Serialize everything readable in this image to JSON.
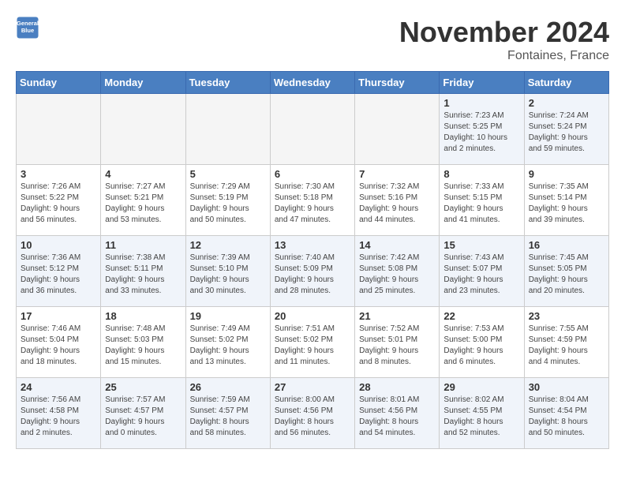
{
  "logo": {
    "line1": "General",
    "line2": "Blue"
  },
  "title": "November 2024",
  "location": "Fontaines, France",
  "days_header": [
    "Sunday",
    "Monday",
    "Tuesday",
    "Wednesday",
    "Thursday",
    "Friday",
    "Saturday"
  ],
  "weeks": [
    [
      {
        "num": "",
        "info": ""
      },
      {
        "num": "",
        "info": ""
      },
      {
        "num": "",
        "info": ""
      },
      {
        "num": "",
        "info": ""
      },
      {
        "num": "",
        "info": ""
      },
      {
        "num": "1",
        "info": "Sunrise: 7:23 AM\nSunset: 5:25 PM\nDaylight: 10 hours\nand 2 minutes."
      },
      {
        "num": "2",
        "info": "Sunrise: 7:24 AM\nSunset: 5:24 PM\nDaylight: 9 hours\nand 59 minutes."
      }
    ],
    [
      {
        "num": "3",
        "info": "Sunrise: 7:26 AM\nSunset: 5:22 PM\nDaylight: 9 hours\nand 56 minutes."
      },
      {
        "num": "4",
        "info": "Sunrise: 7:27 AM\nSunset: 5:21 PM\nDaylight: 9 hours\nand 53 minutes."
      },
      {
        "num": "5",
        "info": "Sunrise: 7:29 AM\nSunset: 5:19 PM\nDaylight: 9 hours\nand 50 minutes."
      },
      {
        "num": "6",
        "info": "Sunrise: 7:30 AM\nSunset: 5:18 PM\nDaylight: 9 hours\nand 47 minutes."
      },
      {
        "num": "7",
        "info": "Sunrise: 7:32 AM\nSunset: 5:16 PM\nDaylight: 9 hours\nand 44 minutes."
      },
      {
        "num": "8",
        "info": "Sunrise: 7:33 AM\nSunset: 5:15 PM\nDaylight: 9 hours\nand 41 minutes."
      },
      {
        "num": "9",
        "info": "Sunrise: 7:35 AM\nSunset: 5:14 PM\nDaylight: 9 hours\nand 39 minutes."
      }
    ],
    [
      {
        "num": "10",
        "info": "Sunrise: 7:36 AM\nSunset: 5:12 PM\nDaylight: 9 hours\nand 36 minutes."
      },
      {
        "num": "11",
        "info": "Sunrise: 7:38 AM\nSunset: 5:11 PM\nDaylight: 9 hours\nand 33 minutes."
      },
      {
        "num": "12",
        "info": "Sunrise: 7:39 AM\nSunset: 5:10 PM\nDaylight: 9 hours\nand 30 minutes."
      },
      {
        "num": "13",
        "info": "Sunrise: 7:40 AM\nSunset: 5:09 PM\nDaylight: 9 hours\nand 28 minutes."
      },
      {
        "num": "14",
        "info": "Sunrise: 7:42 AM\nSunset: 5:08 PM\nDaylight: 9 hours\nand 25 minutes."
      },
      {
        "num": "15",
        "info": "Sunrise: 7:43 AM\nSunset: 5:07 PM\nDaylight: 9 hours\nand 23 minutes."
      },
      {
        "num": "16",
        "info": "Sunrise: 7:45 AM\nSunset: 5:05 PM\nDaylight: 9 hours\nand 20 minutes."
      }
    ],
    [
      {
        "num": "17",
        "info": "Sunrise: 7:46 AM\nSunset: 5:04 PM\nDaylight: 9 hours\nand 18 minutes."
      },
      {
        "num": "18",
        "info": "Sunrise: 7:48 AM\nSunset: 5:03 PM\nDaylight: 9 hours\nand 15 minutes."
      },
      {
        "num": "19",
        "info": "Sunrise: 7:49 AM\nSunset: 5:02 PM\nDaylight: 9 hours\nand 13 minutes."
      },
      {
        "num": "20",
        "info": "Sunrise: 7:51 AM\nSunset: 5:02 PM\nDaylight: 9 hours\nand 11 minutes."
      },
      {
        "num": "21",
        "info": "Sunrise: 7:52 AM\nSunset: 5:01 PM\nDaylight: 9 hours\nand 8 minutes."
      },
      {
        "num": "22",
        "info": "Sunrise: 7:53 AM\nSunset: 5:00 PM\nDaylight: 9 hours\nand 6 minutes."
      },
      {
        "num": "23",
        "info": "Sunrise: 7:55 AM\nSunset: 4:59 PM\nDaylight: 9 hours\nand 4 minutes."
      }
    ],
    [
      {
        "num": "24",
        "info": "Sunrise: 7:56 AM\nSunset: 4:58 PM\nDaylight: 9 hours\nand 2 minutes."
      },
      {
        "num": "25",
        "info": "Sunrise: 7:57 AM\nSunset: 4:57 PM\nDaylight: 9 hours\nand 0 minutes."
      },
      {
        "num": "26",
        "info": "Sunrise: 7:59 AM\nSunset: 4:57 PM\nDaylight: 8 hours\nand 58 minutes."
      },
      {
        "num": "27",
        "info": "Sunrise: 8:00 AM\nSunset: 4:56 PM\nDaylight: 8 hours\nand 56 minutes."
      },
      {
        "num": "28",
        "info": "Sunrise: 8:01 AM\nSunset: 4:56 PM\nDaylight: 8 hours\nand 54 minutes."
      },
      {
        "num": "29",
        "info": "Sunrise: 8:02 AM\nSunset: 4:55 PM\nDaylight: 8 hours\nand 52 minutes."
      },
      {
        "num": "30",
        "info": "Sunrise: 8:04 AM\nSunset: 4:54 PM\nDaylight: 8 hours\nand 50 minutes."
      }
    ]
  ]
}
